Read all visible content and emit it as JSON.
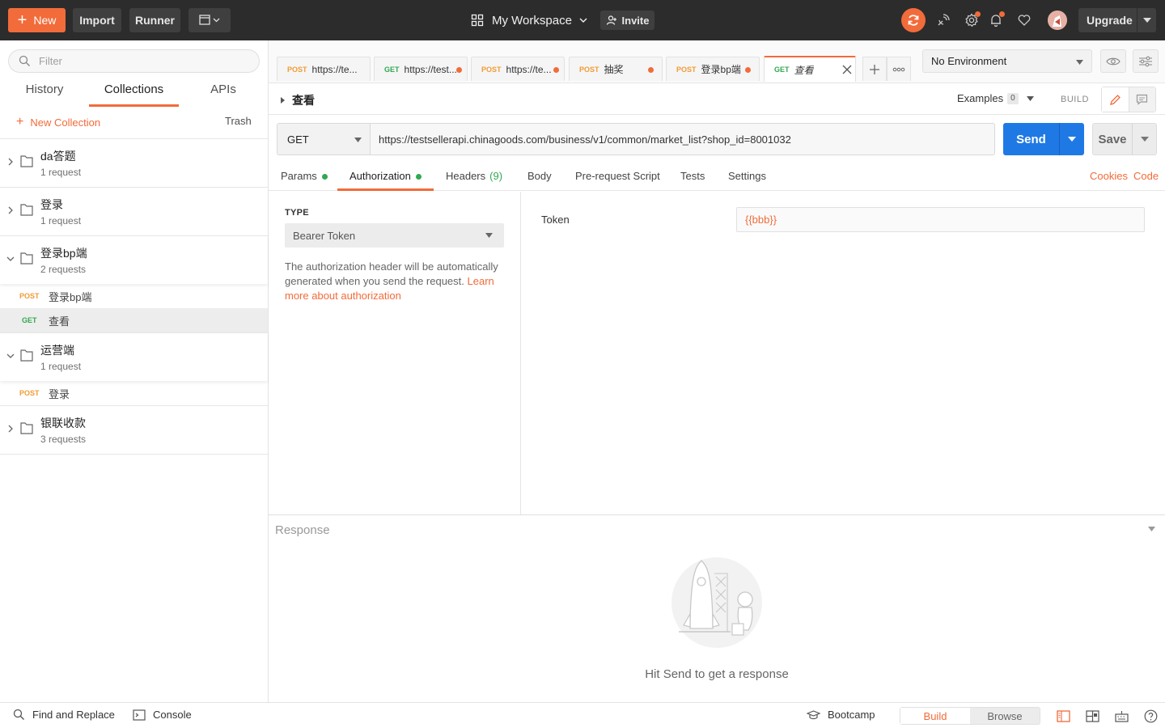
{
  "topbar": {
    "new_label": "New",
    "import_label": "Import",
    "runner_label": "Runner",
    "workspace_label": "My Workspace",
    "invite_label": "Invite",
    "upgrade_label": "Upgrade",
    "accent": "#f26b3a",
    "icons": [
      "sync-icon",
      "satellite-icon",
      "settings-icon",
      "bell-icon",
      "heart-icon",
      "avatar"
    ]
  },
  "sidebar": {
    "filter_placeholder": "Filter",
    "tabs": [
      {
        "label": "History",
        "active": false
      },
      {
        "label": "Collections",
        "active": true
      },
      {
        "label": "APIs",
        "active": false
      }
    ],
    "new_collection_label": "New Collection",
    "trash_label": "Trash",
    "collections": [
      {
        "name": "da答题",
        "count": "1 request",
        "expanded": false,
        "requests": []
      },
      {
        "name": "登录",
        "count": "1 request",
        "expanded": false,
        "requests": []
      },
      {
        "name": "登录bp端",
        "count": "2 requests",
        "expanded": true,
        "requests": [
          {
            "method": "POST",
            "name": "登录bp端",
            "selected": false
          },
          {
            "method": "GET",
            "name": "查看",
            "selected": true
          }
        ]
      },
      {
        "name": "运营端",
        "count": "1 request",
        "expanded": true,
        "requests": [
          {
            "method": "POST",
            "name": "登录",
            "selected": false
          }
        ]
      },
      {
        "name": "银联收款",
        "count": "3 requests",
        "expanded": false,
        "requests": []
      }
    ]
  },
  "request_tabs": [
    {
      "method": "POST",
      "title": "https://te...",
      "unsaved": false,
      "active": false
    },
    {
      "method": "GET",
      "title": "https://test...",
      "unsaved": true,
      "active": false
    },
    {
      "method": "POST",
      "title": "https://te...",
      "unsaved": true,
      "active": false
    },
    {
      "method": "POST",
      "title": "抽奖",
      "unsaved": true,
      "active": false
    },
    {
      "method": "POST",
      "title": "登录bp端",
      "unsaved": true,
      "active": false
    },
    {
      "method": "GET",
      "title": "查看",
      "unsaved": false,
      "active": true
    }
  ],
  "environment": {
    "selected": "No Environment"
  },
  "request": {
    "name": "查看",
    "examples_label": "Examples",
    "examples_count": "0",
    "build_label": "BUILD",
    "method": "GET",
    "url": "https://testsellerapi.chinagoods.com/business/v1/common/market_list?shop_id=8001032",
    "send_label": "Send",
    "save_label": "Save"
  },
  "sub_tabs": [
    {
      "label": "Params",
      "dot": true,
      "count": ""
    },
    {
      "label": "Authorization",
      "dot": true,
      "count": "",
      "active": true
    },
    {
      "label": "Headers",
      "dot": false,
      "count": "(9)"
    },
    {
      "label": "Body",
      "dot": false,
      "count": ""
    },
    {
      "label": "Pre-request Script",
      "dot": false,
      "count": ""
    },
    {
      "label": "Tests",
      "dot": false,
      "count": ""
    },
    {
      "label": "Settings",
      "dot": false,
      "count": ""
    }
  ],
  "sub_links": {
    "cookies": "Cookies",
    "code": "Code"
  },
  "auth": {
    "type_label": "TYPE",
    "type_value": "Bearer Token",
    "desc_text": "The authorization header will be automatically generated when you send the request. ",
    "desc_link": "Learn more about authorization",
    "token_label": "Token",
    "token_value": "{{bbb}}"
  },
  "response": {
    "title": "Response",
    "empty_message": "Hit Send to get a response"
  },
  "footer": {
    "find_replace": "Find and Replace",
    "console": "Console",
    "bootcamp": "Bootcamp",
    "build": "Build",
    "browse": "Browse"
  }
}
